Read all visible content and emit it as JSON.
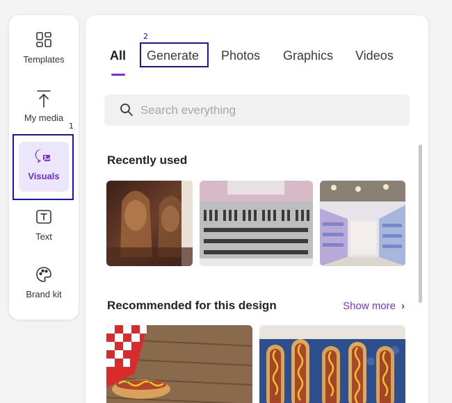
{
  "sidebar": {
    "items": [
      {
        "label": "Templates",
        "icon": "templates-icon"
      },
      {
        "label": "My media",
        "icon": "upload-icon"
      },
      {
        "label": "Visuals",
        "icon": "visuals-icon",
        "active": true
      },
      {
        "label": "Text",
        "icon": "text-icon"
      },
      {
        "label": "Brand kit",
        "icon": "palette-icon"
      }
    ]
  },
  "annotations": [
    "1",
    "2"
  ],
  "tabs": [
    {
      "label": "All",
      "active": true
    },
    {
      "label": "Generate"
    },
    {
      "label": "Photos"
    },
    {
      "label": "Graphics"
    },
    {
      "label": "Videos"
    }
  ],
  "search": {
    "placeholder": "Search everything"
  },
  "recent": {
    "title": "Recently used"
  },
  "recommended": {
    "title": "Recommended for this design",
    "show_more": "Show more"
  },
  "colors": {
    "accent": "#7b2fe0",
    "highlight": "#1212c8",
    "active_bg": "#ece6fb"
  }
}
